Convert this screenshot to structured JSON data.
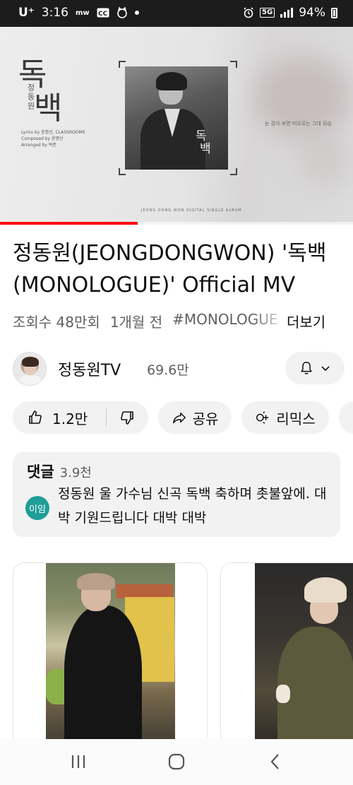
{
  "status_bar": {
    "carrier": "U⁺",
    "time": "3:16",
    "left_icons": [
      "mw",
      "cc-icon",
      "cat-icon"
    ],
    "network": "5G",
    "battery": "94%"
  },
  "player": {
    "art_title_line1": "독",
    "art_title_line2": "백",
    "art_artist": "정동원",
    "art_credits": [
      "Lyrics by 윤명선, CLASSROOMS",
      "Composed by 윤명선",
      "Arranged by 박준"
    ],
    "cover_text_line1": "독",
    "cover_text_line2": "백",
    "art_right_text": "눈 감아 보면 떠오르는 그대 모습",
    "art_bottom_text": "JEONG DONG WON DIGITAL SINGLE ALBUM",
    "progress": 0.39,
    "accent": "#ff0000"
  },
  "video": {
    "title": "정동원(JEONGDONGWON) '독백(MONOLOGUE)' Official MV",
    "views": "조회수 48만회",
    "time_ago": "1개월 전",
    "hashtag": "#MONOLOGUE",
    "more": "더보기"
  },
  "channel": {
    "name": "정동원TV",
    "subscribers": "69.6만"
  },
  "actions": {
    "likes": "1.2만",
    "share": "공유",
    "remix": "리믹스"
  },
  "comments": {
    "title": "댓글",
    "count": "3.9천",
    "top_avatar": "이임",
    "avatar_color": "#1e9e97",
    "top_comment": "정동원 울 가수님 신곡 독백 축하며 촛불앞에. 대박 기원드립니다 대박 대박"
  }
}
